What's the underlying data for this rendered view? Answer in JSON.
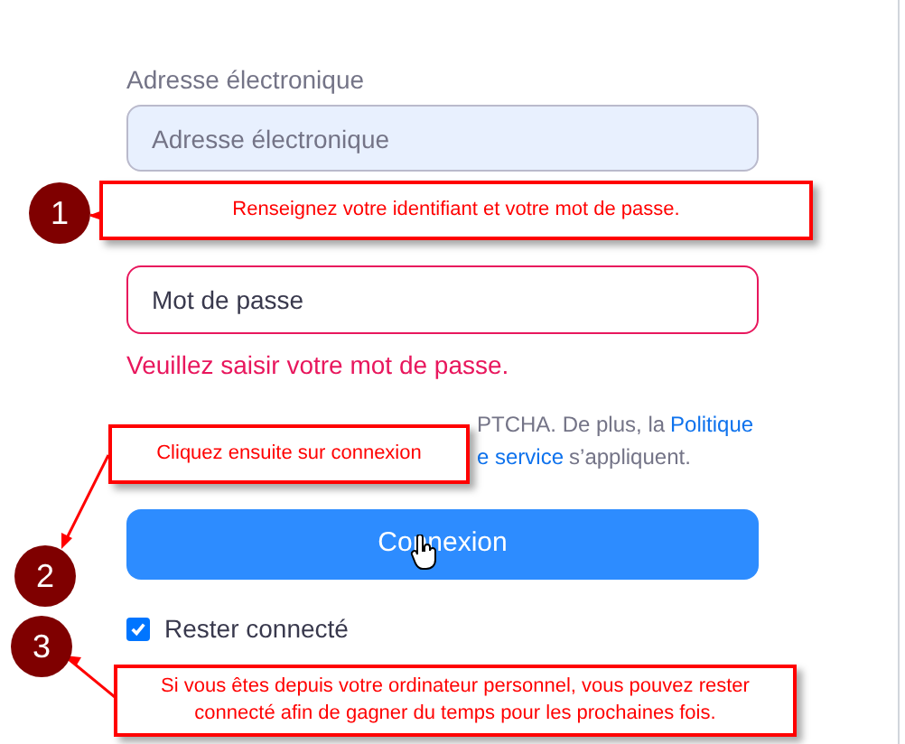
{
  "form": {
    "email_label": "Adresse électronique",
    "email_placeholder": "Adresse électronique",
    "password_placeholder": "Mot de passe",
    "password_error": "Veuillez saisir votre mot de passe.",
    "notice_line_1": "PTCHA. De plus, la",
    "notice_link_1": "Politique",
    "notice_link_2": "e service",
    "notice_line_2": "s’appliquent.",
    "submit": "Connexion",
    "remember": {
      "label": "Rester connecté",
      "checked": true
    }
  },
  "callouts": [
    {
      "number": "1",
      "text": "Renseignez votre identifiant et votre mot de passe."
    },
    {
      "number": "2",
      "text": "Cliquez ensuite sur connexion"
    },
    {
      "number": "3",
      "text": "Si vous êtes depuis votre ordinateur personnel, vous pouvez rester connecté afin de gagner du temps pour les prochaines fois."
    }
  ]
}
